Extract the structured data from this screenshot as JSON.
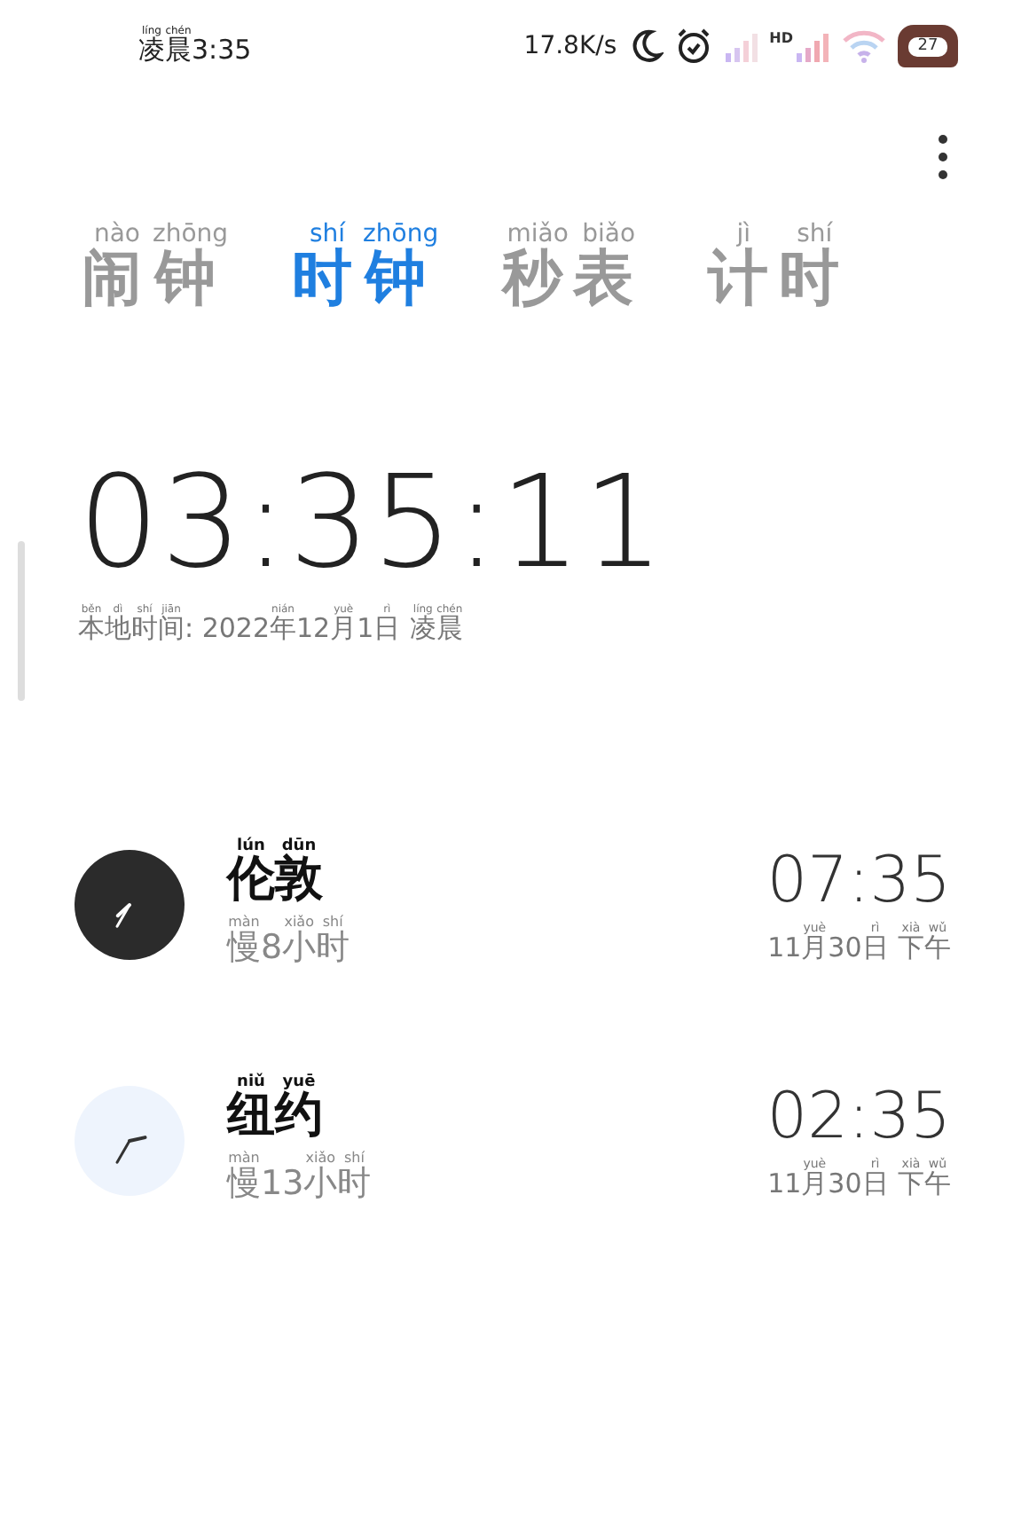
{
  "status_bar": {
    "time": [
      {
        "t": "凌",
        "py": "líng"
      },
      {
        "t": "晨",
        "py": "chén"
      },
      {
        "t": "3:35"
      }
    ],
    "net_speed": "17.8K/s",
    "signal_label": "HD",
    "battery": "27"
  },
  "tabs": [
    {
      "segments": [
        {
          "t": "闹",
          "py": "nào"
        },
        {
          "t": "钟",
          "py": "zhōng"
        }
      ],
      "selected": false
    },
    {
      "segments": [
        {
          "t": "时",
          "py": "shí"
        },
        {
          "t": "钟",
          "py": "zhōng"
        }
      ],
      "selected": true
    },
    {
      "segments": [
        {
          "t": "秒",
          "py": "miǎo"
        },
        {
          "t": "表",
          "py": "biǎo"
        }
      ],
      "selected": false
    },
    {
      "segments": [
        {
          "t": "计",
          "py": "jì"
        },
        {
          "t": "时",
          "py": "shí"
        }
      ],
      "selected": false
    }
  ],
  "local": {
    "time": "03:35:11",
    "date": [
      {
        "t": "本",
        "py": "běn"
      },
      {
        "t": "地",
        "py": "dì"
      },
      {
        "t": "时",
        "py": "shí"
      },
      {
        "t": "间",
        "py": "jiān"
      },
      {
        "t": ": 2022"
      },
      {
        "t": "年",
        "py": "nián"
      },
      {
        "t": "12"
      },
      {
        "t": "月",
        "py": "yuè"
      },
      {
        "t": "1"
      },
      {
        "t": "日",
        "py": "rì"
      },
      {
        "t": "凌",
        "py": "líng",
        "space_before": true
      },
      {
        "t": "晨",
        "py": "chén"
      }
    ]
  },
  "cities": [
    {
      "kind": "dark",
      "name": [
        {
          "t": "伦",
          "py": "lún"
        },
        {
          "t": "敦",
          "py": "dūn"
        }
      ],
      "offset": [
        {
          "t": "慢",
          "py": "màn"
        },
        {
          "t": "8"
        },
        {
          "t": "小",
          "py": "xiǎo"
        },
        {
          "t": "时",
          "py": "shí"
        }
      ],
      "time": "07:35",
      "date": [
        {
          "t": "11"
        },
        {
          "t": "月",
          "py": "yuè"
        },
        {
          "t": "30"
        },
        {
          "t": "日",
          "py": "rì"
        },
        {
          "t": "下",
          "py": "xià",
          "space_before": true
        },
        {
          "t": "午",
          "py": "wǔ"
        }
      ]
    },
    {
      "kind": "light",
      "name": [
        {
          "t": "纽",
          "py": "niǔ"
        },
        {
          "t": "约",
          "py": "yuē"
        }
      ],
      "offset": [
        {
          "t": "慢",
          "py": "màn"
        },
        {
          "t": "13"
        },
        {
          "t": "小",
          "py": "xiǎo"
        },
        {
          "t": "时",
          "py": "shí"
        }
      ],
      "time": "02:35",
      "date": [
        {
          "t": "11"
        },
        {
          "t": "月",
          "py": "yuè"
        },
        {
          "t": "30"
        },
        {
          "t": "日",
          "py": "rì"
        },
        {
          "t": "下",
          "py": "xià",
          "space_before": true
        },
        {
          "t": "午",
          "py": "wǔ"
        }
      ]
    }
  ]
}
